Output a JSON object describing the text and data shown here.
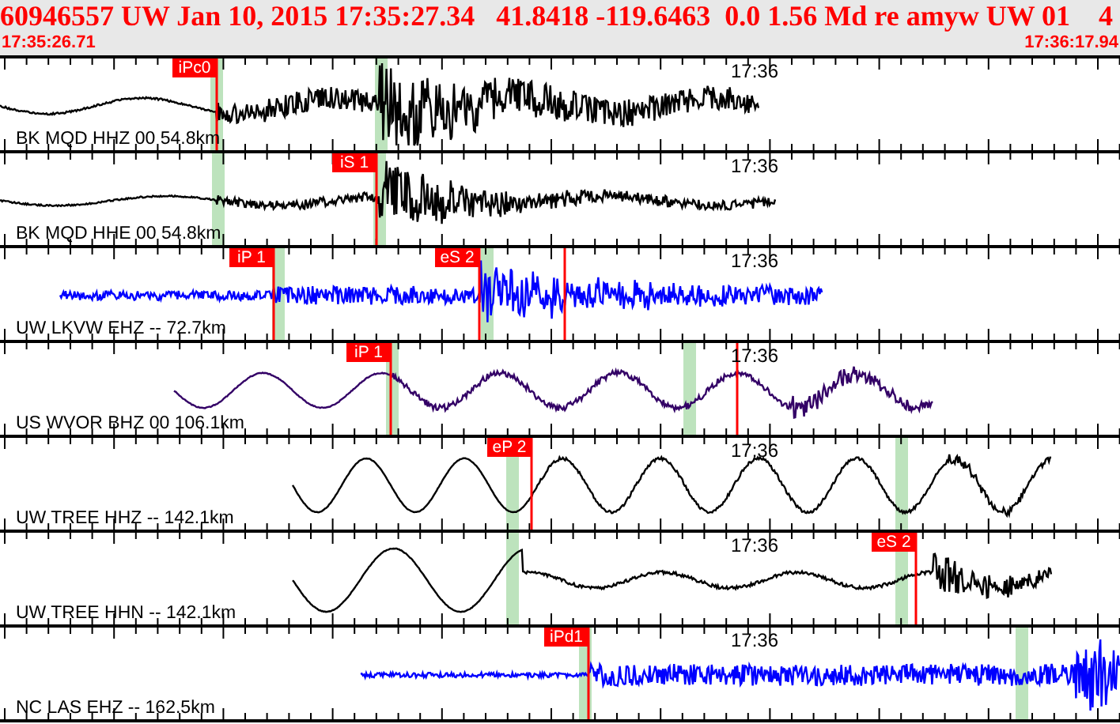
{
  "header": {
    "title": "60946557 UW Jan 10, 2015 17:35:27.34   41.8418 -119.6463  0.0 1.56 Md re amyw UW 01    4",
    "start_time": "17:35:26.71",
    "end_time": "17:36:17.94"
  },
  "channels": [
    {
      "label": "BK MQD HHZ 00 54.8km",
      "time_label": "17:36",
      "color": "#000000",
      "picks": [
        {
          "label": "iPc0"
        }
      ]
    },
    {
      "label": "BK MQD HHE 00 54.8km",
      "time_label": "17:36",
      "color": "#000000",
      "picks": [
        {
          "label": "iS 1"
        }
      ]
    },
    {
      "label": "UW LKVW EHZ -- 72.7km",
      "time_label": "17:36",
      "color": "#0000ff",
      "picks": [
        {
          "label": "iP 1"
        },
        {
          "label": "eS 2"
        }
      ]
    },
    {
      "label": "US WVOR BHZ 00 106.1km",
      "time_label": "17:36",
      "color": "#330066",
      "picks": [
        {
          "label": "iP 1"
        }
      ]
    },
    {
      "label": "UW TREE HHZ -- 142.1km",
      "time_label": "17:36",
      "color": "#000000",
      "picks": [
        {
          "label": "eP 2"
        }
      ]
    },
    {
      "label": "UW TREE HHN -- 142.1km",
      "time_label": "17:36",
      "color": "#000000",
      "picks": [
        {
          "label": "eS 2"
        }
      ]
    },
    {
      "label": "NC LAS EHZ -- 162.5km",
      "time_label": "17:36",
      "color": "#0000ff",
      "picks": [
        {
          "label": "iPd1"
        }
      ]
    }
  ]
}
